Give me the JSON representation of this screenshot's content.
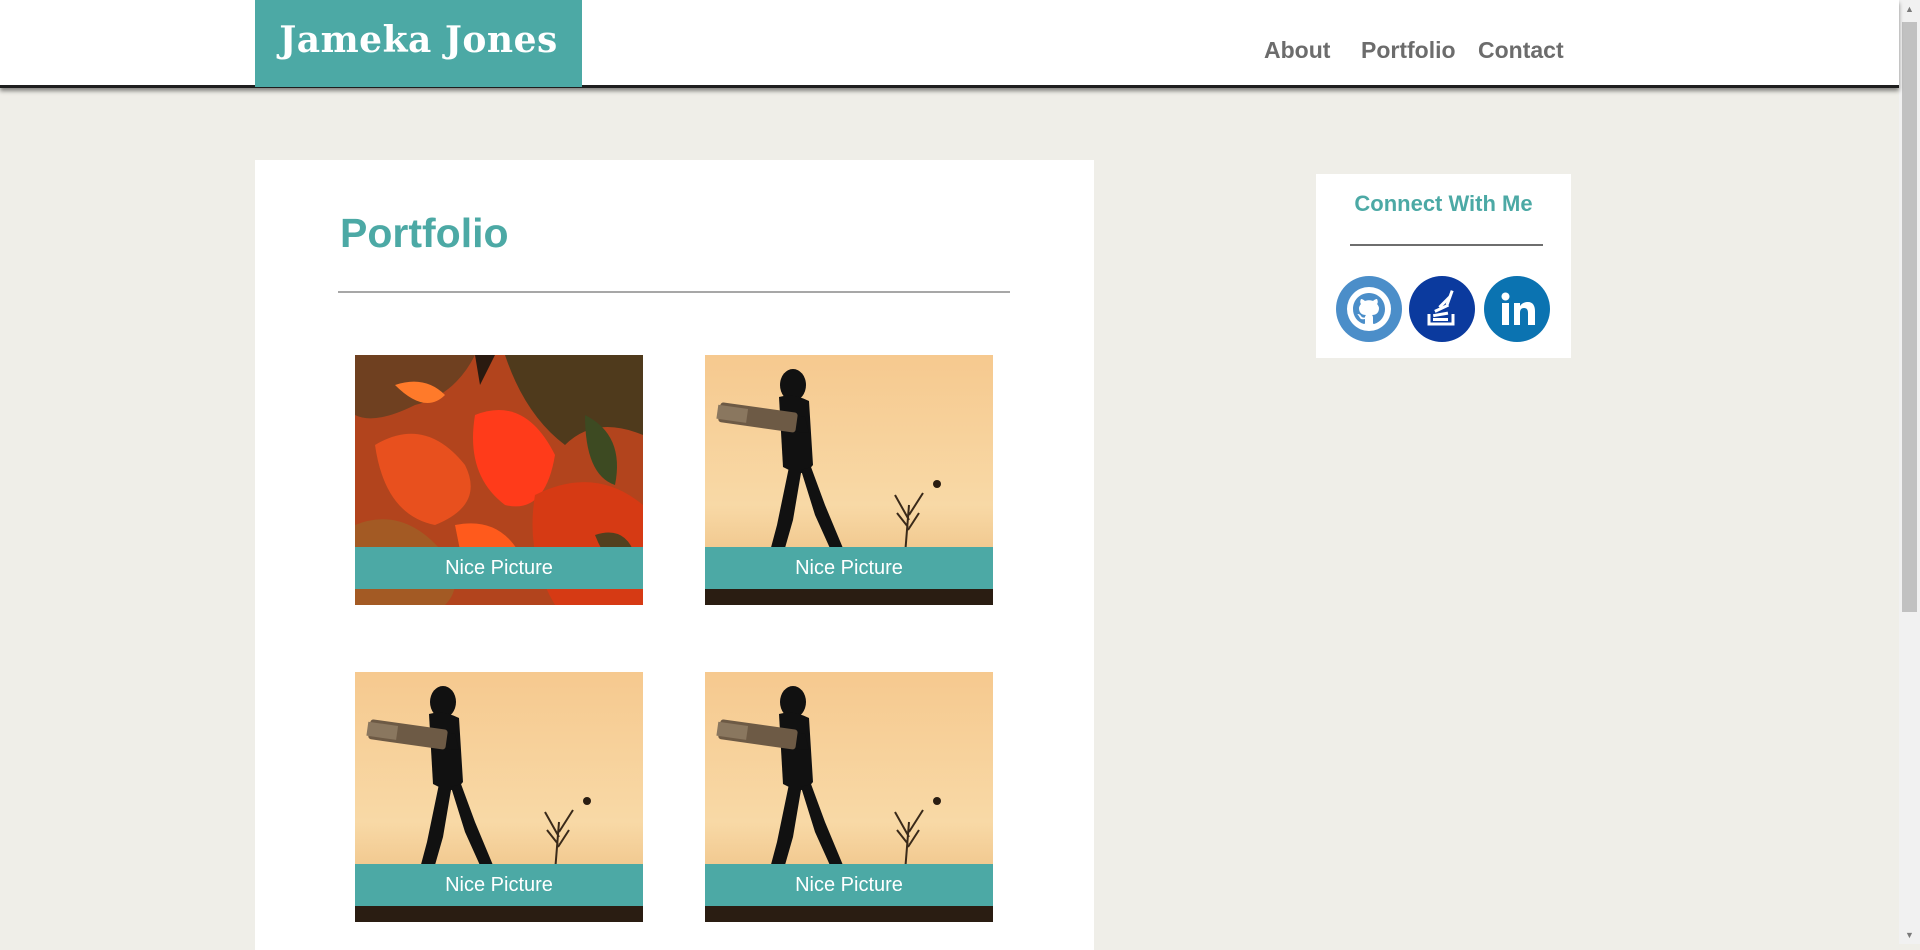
{
  "header": {
    "brand": "Jameka Jones",
    "nav": [
      "About",
      "Portfolio",
      "Contact"
    ]
  },
  "main": {
    "title": "Portfolio",
    "items": [
      {
        "caption": "Nice Picture",
        "image": "abstract-orange-painting"
      },
      {
        "caption": "Nice Picture",
        "image": "cricket-batsman-silhouette"
      },
      {
        "caption": "Nice Picture",
        "image": "cricket-batsman-silhouette"
      },
      {
        "caption": "Nice Picture",
        "image": "cricket-batsman-silhouette"
      }
    ]
  },
  "sidebar": {
    "title": "Connect With Me",
    "links": [
      {
        "icon": "github-icon",
        "color": "#4b8ec9"
      },
      {
        "icon": "stackoverflow-icon",
        "color": "#0b3a9e"
      },
      {
        "icon": "linkedin-icon",
        "color": "#0b73b1"
      }
    ]
  },
  "colors": {
    "accent": "#4ca9a5",
    "page_background": "#efeee8",
    "nav_text": "#6c6c6c"
  }
}
